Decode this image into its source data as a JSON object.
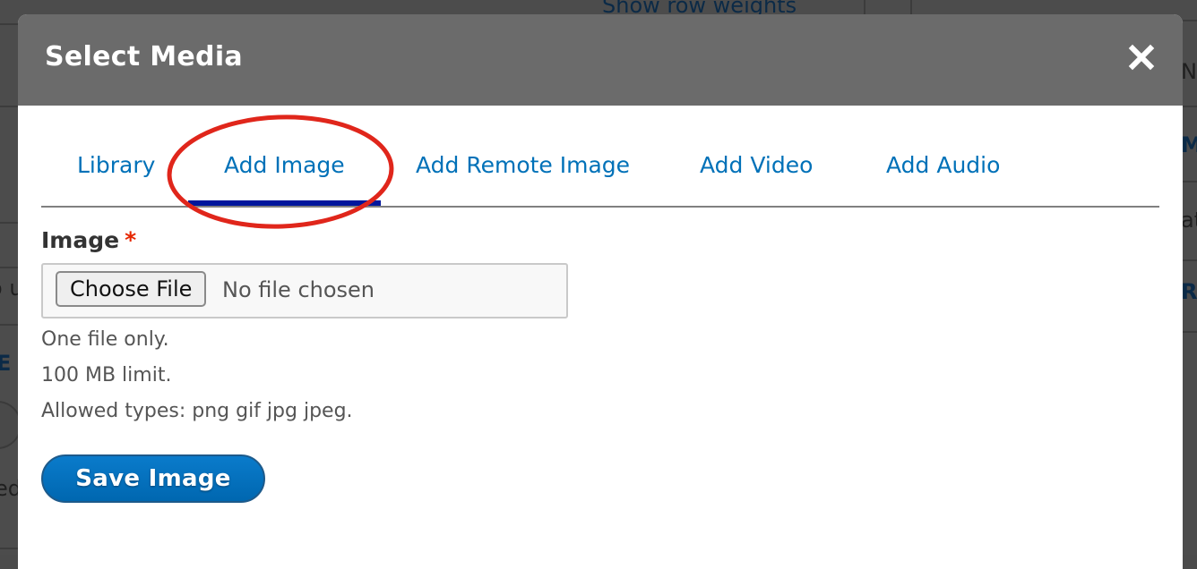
{
  "background": {
    "top_link": "Show row weights",
    "right_fragments": [
      "No",
      "MA",
      "at",
      "R"
    ],
    "left_fragments": [
      "o u",
      "E",
      "ed"
    ]
  },
  "dialog": {
    "title": "Select Media",
    "close_icon": "close-icon",
    "close_label": "Close"
  },
  "tabs": [
    {
      "label": "Library",
      "active": false
    },
    {
      "label": "Add Image",
      "active": true
    },
    {
      "label": "Add Remote Image",
      "active": false
    },
    {
      "label": "Add Video",
      "active": false
    },
    {
      "label": "Add Audio",
      "active": false
    }
  ],
  "form": {
    "image_label": "Image",
    "required_marker": "*",
    "choose_file_label": "Choose File",
    "file_status": "No file chosen",
    "help_lines": [
      "One file only.",
      "100 MB limit.",
      "Allowed types: png gif jpg jpeg."
    ],
    "save_label": "Save Image"
  },
  "colors": {
    "link": "#0071b8",
    "active_tab_underline": "#00169c",
    "titlebar": "#6b6b6b",
    "required": "#e62600",
    "primary_button": "#0071b8",
    "annotation": "#e0261b"
  },
  "annotation": {
    "type": "ellipse",
    "target": "Add Image tab"
  }
}
